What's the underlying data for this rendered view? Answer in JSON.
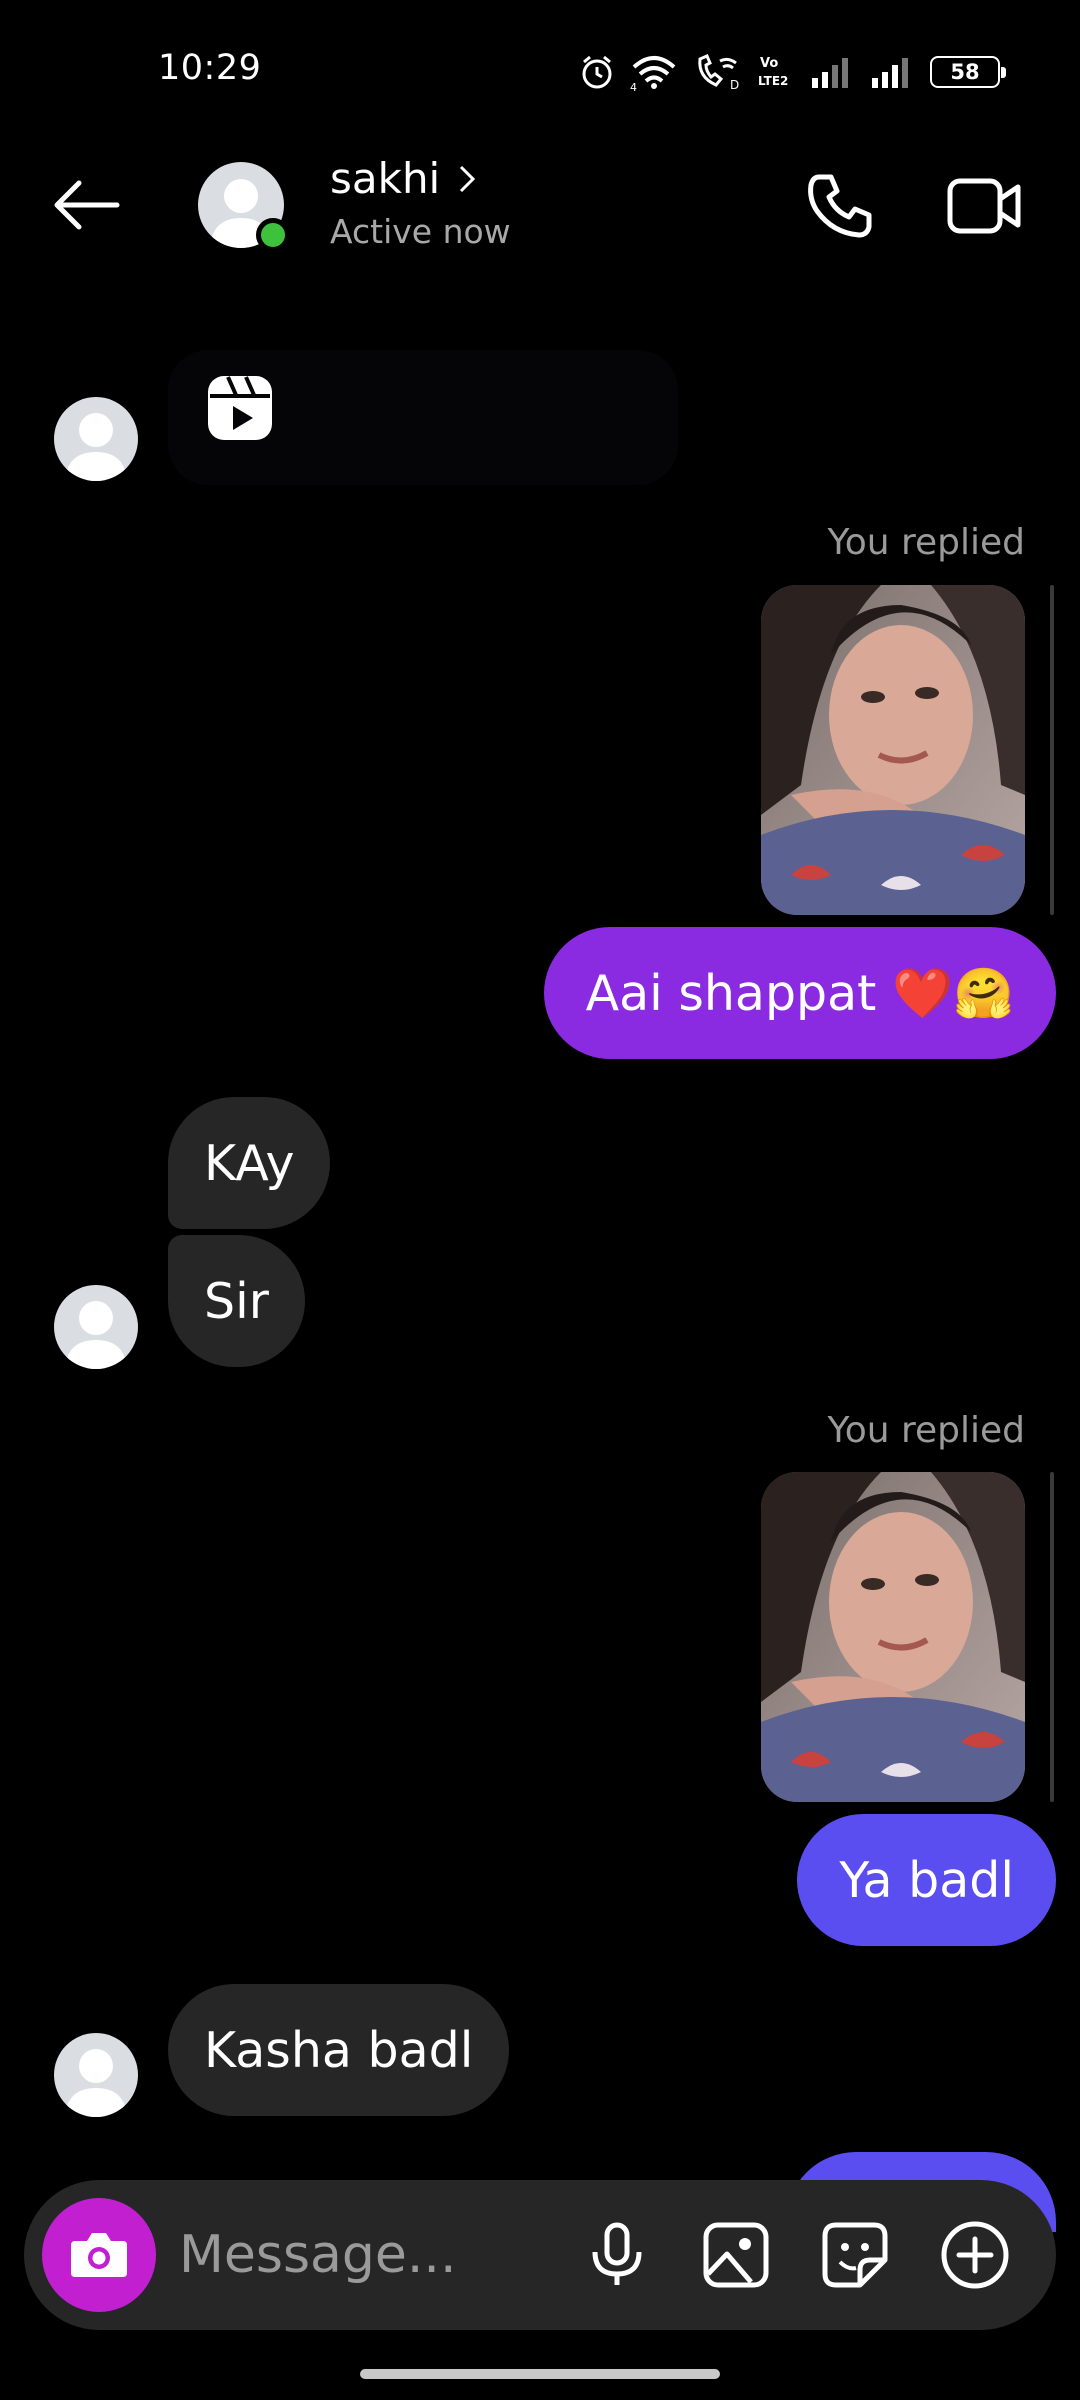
{
  "status_bar": {
    "time": "10:29",
    "battery": "58"
  },
  "header": {
    "contact_name": "sakhi",
    "contact_status": "Active now",
    "name_chevron": "›"
  },
  "messages": {
    "reply_label_1": "You replied",
    "out_1": "Aai shappat ❤️🤗",
    "in_1": "KAy",
    "in_2": "Sir",
    "reply_label_2": "You replied",
    "out_2": "Ya badl",
    "in_3": "Kasha badl"
  },
  "composer": {
    "placeholder": "Message..."
  },
  "colors": {
    "accent_purple": "#8a2be2",
    "accent_blue": "#5b4ef0",
    "camera_magenta": "#c21fd1",
    "incoming_bubble": "#262626",
    "online_green": "#3ec23e"
  },
  "icons": [
    "alarm-icon",
    "wifi-icon",
    "wifi-calling-icon",
    "volte-icon",
    "signal-icon",
    "battery-icon",
    "back-arrow-icon",
    "phone-icon",
    "video-camera-icon",
    "reel-icon",
    "camera-icon",
    "microphone-icon",
    "gallery-icon",
    "sticker-icon",
    "plus-circle-icon"
  ]
}
